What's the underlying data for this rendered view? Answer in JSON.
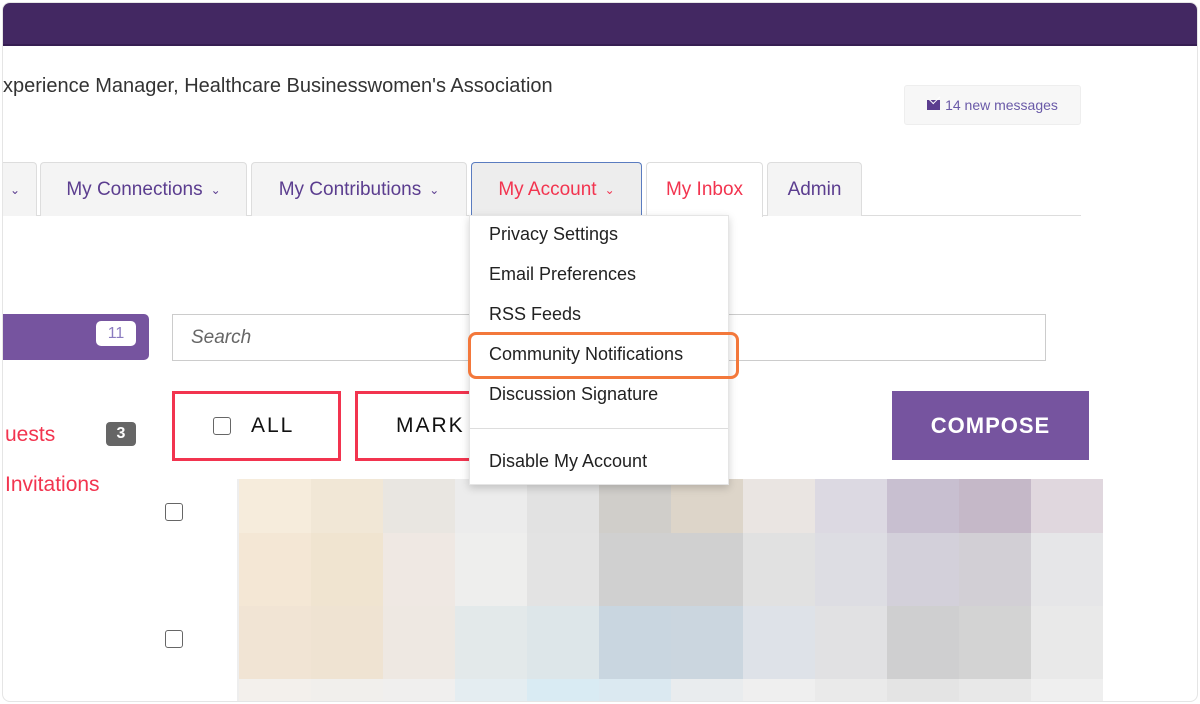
{
  "header": {
    "subtitle": "xperience Manager, Healthcare Businesswomen's Association",
    "messages": "14 new messages",
    "messages_icon": "envelope-icon"
  },
  "tabs": [
    {
      "label": "My Connections"
    },
    {
      "label": "My Contributions"
    },
    {
      "label": "My Account",
      "active": true
    },
    {
      "label": "My Inbox"
    },
    {
      "label": "Admin"
    }
  ],
  "dropdown": {
    "items": [
      "Privacy Settings",
      "Email Preferences",
      "RSS Feeds",
      "Community Notifications",
      "Discussion Signature",
      "Disable My Account"
    ],
    "highlighted": "Community Notifications",
    "highlight_color": "#f3783b"
  },
  "sidebar": {
    "folder_count": "11",
    "links": [
      {
        "label": "uests",
        "count": "3"
      },
      {
        "label": "Invitations"
      }
    ]
  },
  "search": {
    "placeholder": "Search"
  },
  "actions": {
    "all": "ALL",
    "mark": "MARK",
    "compose": "COMPOSE"
  },
  "colors": {
    "brand": "#432862",
    "accent": "#76549f",
    "alert": "#f2344f"
  }
}
